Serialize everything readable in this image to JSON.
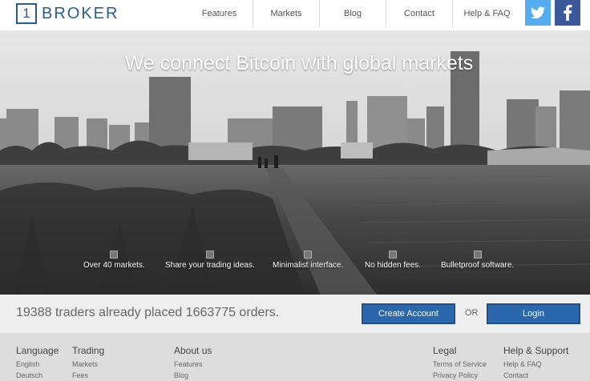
{
  "header": {
    "logo_mark": "1",
    "logo_text": "BROKER",
    "nav": [
      "Features",
      "Markets",
      "Blog",
      "Contact",
      "Help & FAQ"
    ]
  },
  "hero": {
    "title": "We connect Bitcoin with global markets",
    "features": [
      "Over 40 markets.",
      "Share your trading ideas.",
      "Minimalist interface.",
      "No hidden fees.",
      "Bulletproof software."
    ]
  },
  "stats": {
    "text": "19388 traders already placed 1663775 orders.",
    "create_label": "Create Account",
    "or_label": "OR",
    "login_label": "Login"
  },
  "footer": {
    "language": {
      "title": "Language",
      "links": [
        "English",
        "Deutsch"
      ]
    },
    "trading": {
      "title": "Trading",
      "links": [
        "Markets",
        "Fees"
      ]
    },
    "about": {
      "title": "About us",
      "links": [
        "Features",
        "Blog"
      ]
    },
    "legal": {
      "title": "Legal",
      "links": [
        "Terms of Service",
        "Privacy Policy"
      ]
    },
    "support": {
      "title": "Help & Support",
      "links": [
        "Help & FAQ",
        "Contact"
      ]
    }
  },
  "icons": {
    "twitter": "twitter-icon",
    "facebook": "facebook-icon",
    "feature_icon": "broken-image-icon"
  },
  "colors": {
    "brand": "#2a5d8f",
    "button": "#2a67ad",
    "twitter": "#55acee",
    "facebook": "#3b5998"
  }
}
